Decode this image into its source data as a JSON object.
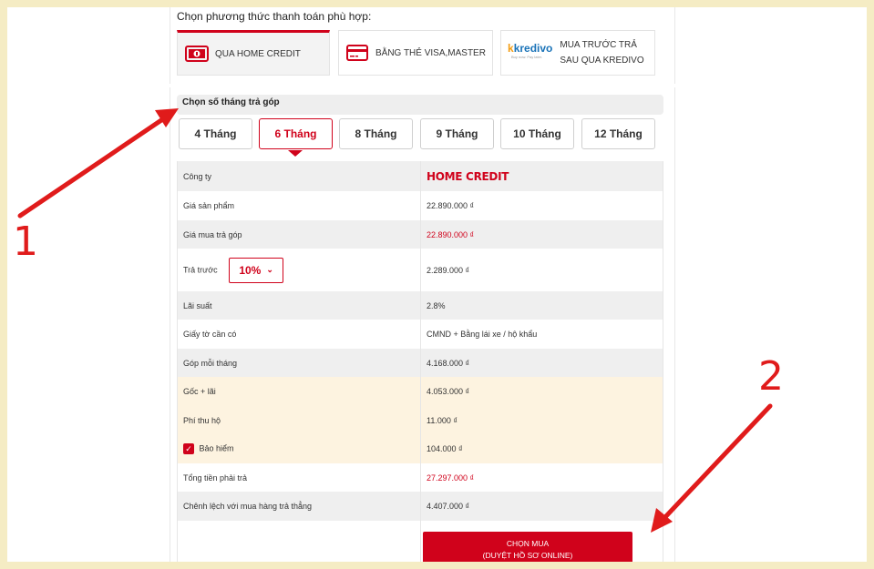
{
  "payment": {
    "title": "Chọn phương thức thanh toán phù hợp:",
    "options": [
      {
        "label": "QUA HOME CREDIT",
        "icon": "home-credit-icon",
        "active": true
      },
      {
        "label": "BẰNG THẺ VISA,MASTER",
        "icon": "credit-card-icon",
        "active": false
      },
      {
        "label": "MUA TRƯỚC TRẢ SAU QUA KREDIVO",
        "label_line1": "MUA TRƯỚC TRẢ",
        "label_line2": "SAU QUA KREDIVO",
        "icon": "kredivo-logo",
        "logo_text": "kredivo",
        "active": false
      }
    ]
  },
  "installment": {
    "heading": "Chọn số tháng trả góp",
    "tabs": [
      "4 Tháng",
      "6 Tháng",
      "8 Tháng",
      "9 Tháng",
      "10 Tháng",
      "12 Tháng"
    ],
    "selected_tab": "6 Tháng",
    "rows": {
      "company": {
        "label": "Công ty",
        "value": "HOME CREDIT"
      },
      "price": {
        "label": "Giá sản phẩm",
        "value": "22.890.000 ₫"
      },
      "install_price": {
        "label": "Giá mua trả góp",
        "value": "22.890.000 ₫"
      },
      "prepay": {
        "label": "Trả trước",
        "select": "10%",
        "value": "2.289.000 ₫"
      },
      "interest": {
        "label": "Lãi suất",
        "value": "2.8%"
      },
      "documents": {
        "label": "Giấy tờ cần có",
        "value": "CMND + Bằng lái xe / hộ khẩu"
      },
      "monthly": {
        "label": "Góp mỗi tháng",
        "value": "4.168.000 ₫"
      },
      "principal": {
        "label": "Gốc + lãi",
        "value": "4.053.000 ₫"
      },
      "fee": {
        "label": "Phí thu hộ",
        "value": "11.000 ₫"
      },
      "insurance": {
        "label": "Bảo hiểm",
        "value": "104.000 ₫",
        "checked": true
      },
      "total": {
        "label": "Tổng tiền phải trả",
        "value": "27.297.000 ₫"
      },
      "difference": {
        "label": "Chênh lệch với mua hàng trả thẳng",
        "value": "4.407.000 ₫"
      }
    },
    "buy_button": {
      "line1": "CHỌN MUA",
      "line2": "(DUYỆT HỒ SƠ ONLINE)"
    }
  },
  "annotations": {
    "label1": "1",
    "label2": "2"
  },
  "colors": {
    "accent": "#d0021b",
    "background": "#f5ecc4",
    "annotation": "#e01b1b",
    "highlight_row": "#fdf3e0"
  }
}
